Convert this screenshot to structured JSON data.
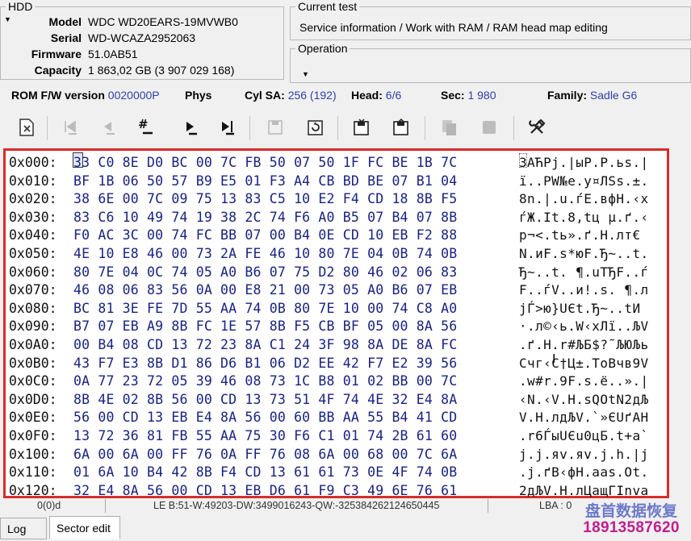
{
  "hdd": {
    "legend": "HDD",
    "model_label": "Model",
    "model": "WDC WD20EARS-19MVWB0",
    "serial_label": "Serial",
    "serial": "WD-WCAZA2952063",
    "firmware_label": "Firmware",
    "firmware": "51.0AB51",
    "capacity_label": "Capacity",
    "capacity": "1 863,02 GB (3 907 029 168)"
  },
  "current_test": {
    "legend": "Current test",
    "value": "Service information / Work with RAM / RAM head map editing"
  },
  "operation": {
    "legend": "Operation",
    "value": ""
  },
  "info_bar": {
    "rom_label": "ROM F/W version",
    "rom_value": "0020000P",
    "phys_label": "Phys",
    "cylsa_label": "Cyl SA:",
    "cylsa_value": "256 (192)",
    "head_label": "Head:",
    "head_value": "6/6",
    "sec_label": "Sec:",
    "sec_value": "1 980",
    "family_label": "Family:",
    "family_value": "Sadle G6"
  },
  "toolbar": {
    "icons": {
      "open": "document-open-icon",
      "first": "go-first-icon",
      "prev": "go-previous-icon",
      "goto": "goto-sector-icon",
      "next": "go-next-icon",
      "last": "go-last-icon",
      "save": "save-icon",
      "refresh": "refresh-icon",
      "save_as": "save-as-icon",
      "save_all": "save-all-icon",
      "copy": "copy-icon",
      "stop": "stop-icon",
      "tools": "tools-icon"
    }
  },
  "hex": {
    "rows": [
      {
        "offset": "0x000:",
        "bytes": "33 C0 8E D0 BC 00 7C FB 50 07 50 1F FC BE 1B 7C",
        "ascii": "3АЋPj.|ыP.P.ьs.|"
      },
      {
        "offset": "0x010:",
        "bytes": "BF 1B 06 50 57 B9 E5 01 F3 A4 CB BD BE 07 B1 04",
        "ascii": "ї..PW№e.у¤ЛЅs.±."
      },
      {
        "offset": "0x020:",
        "bytes": "38 6E 00 7C 09 75 13 83 C5 10 E2 F4 CD 18 8B F5",
        "ascii": "8n.|.u.ѓЕ.вфН.‹х"
      },
      {
        "offset": "0x030:",
        "bytes": "83 C6 10 49 74 19 38 2C 74 F6 A0 B5 07 B4 07 8B",
        "ascii": "ѓЖ.It.8,tц µ.ґ.‹"
      },
      {
        "offset": "0x040:",
        "bytes": "F0 AC 3C 00 74 FC BB 07 00 B4 0E CD 10 EB F2 88",
        "ascii": "р¬<.tь».ґ.Н.лт€"
      },
      {
        "offset": "0x050:",
        "bytes": "4E 10 E8 46 00 73 2A FE 46 10 80 7E 04 0B 74 0B",
        "ascii": "N.иF.s*юF.Ђ~..t."
      },
      {
        "offset": "0x060:",
        "bytes": "80 7E 04 0C 74 05 A0 B6 07 75 D2 80 46 02 06 83",
        "ascii": "Ђ~..t. ¶.uТЂF..ѓ"
      },
      {
        "offset": "0x070:",
        "bytes": "46 08 06 83 56 0A 00 E8 21 00 73 05 A0 B6 07 EB",
        "ascii": "F..ѓV..и!.s. ¶.л"
      },
      {
        "offset": "0x080:",
        "bytes": "BC 81 3E FE 7D 55 AA 74 0B 80 7E 10 00 74 C8 A0",
        "ascii": "јЃ>ю}UЄt.Ђ~..tИ "
      },
      {
        "offset": "0x090:",
        "bytes": "B7 07 EB A9 8B FC 1E 57 8B F5 CB BF 05 00 8A 56",
        "ascii": "·.л©‹ь.W‹хЛї..ЉV"
      },
      {
        "offset": "0x0A0:",
        "bytes": "00 B4 08 CD 13 72 23 8A C1 24 3F 98 8A DE 8A FC",
        "ascii": ".ґ.Н.r#ЉБ$?˜ЉЮЉь"
      },
      {
        "offset": "0x0B0:",
        "bytes": "43 F7 E3 8B D1 86 D6 B1 06 D2 EE 42 F7 E2 39 56",
        "ascii": "Cчг‹С†Ц±.ТоBчв9V"
      },
      {
        "offset": "0x0C0:",
        "bytes": "0A 77 23 72 05 39 46 08 73 1C B8 01 02 BB 00 7C",
        "ascii": ".w#r.9F.s.ё..».|"
      },
      {
        "offset": "0x0D0:",
        "bytes": "8B 4E 02 8B 56 00 CD 13 73 51 4F 74 4E 32 E4 8A",
        "ascii": "‹N.‹V.Н.sQOtN2дЉ"
      },
      {
        "offset": "0x0E0:",
        "bytes": "56 00 CD 13 EB E4 8A 56 00 60 BB AA 55 B4 41 CD",
        "ascii": "V.Н.лдЉV.`»ЄUґAН"
      },
      {
        "offset": "0x0F0:",
        "bytes": "13 72 36 81 FB 55 AA 75 30 F6 C1 01 74 2B 61 60",
        "ascii": ".r6ЃыUЄu0цБ.t+a`"
      },
      {
        "offset": "0x100:",
        "bytes": "6A 00 6A 00 FF 76 0A FF 76 08 6A 00 68 00 7C 6A",
        "ascii": "j.j.яv.яv.j.h.|j"
      },
      {
        "offset": "0x110:",
        "bytes": "01 6A 10 B4 42 8B F4 CD 13 61 61 73 0E 4F 74 0B",
        "ascii": ".j.ґB‹фН.aas.Ot."
      },
      {
        "offset": "0x120:",
        "bytes": "32 E4 8A 56 00 CD 13 EB D6 61 F9 C3 49 6E 76 61",
        "ascii": "2дЉV.Н.лЦaщГInva"
      }
    ]
  },
  "status": {
    "position": "0(0)d",
    "le_values": "LE B:51-W:49203-DW:3499016243-QW:-325384262124650445",
    "lba": "LBA : 0"
  },
  "tabs": {
    "log": "Log",
    "sector_edit": "Sector edit"
  },
  "watermark": {
    "line1": "盘首数据恢复",
    "line2": "18913587620"
  },
  "colors": {
    "accent_blue": "#2d3fa8",
    "highlight_red": "#d92c2a",
    "watermark_pink": "#c21d8e"
  }
}
